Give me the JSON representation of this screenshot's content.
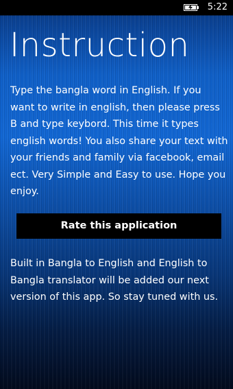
{
  "status_bar": {
    "time": "5:22",
    "battery_icon": "battery-charging-icon"
  },
  "page": {
    "title": "Instruction",
    "instructions": "Type the bangla word in English. If you want to write in english, then please press B and type keybord. This time it types english words! You also share your text with your friends and family via facebook, email ect. Very Simple and Easy to use. Hope you enjoy.",
    "rate_button_label": "Rate this application",
    "note": "Built in Bangla to English and English to Bangla translator will be added our next version of this app. So stay tuned with us."
  },
  "colors": {
    "background_top": "#1060c8",
    "background_bottom": "#020a1c",
    "button_background": "#000000",
    "text": "#ffffff"
  }
}
